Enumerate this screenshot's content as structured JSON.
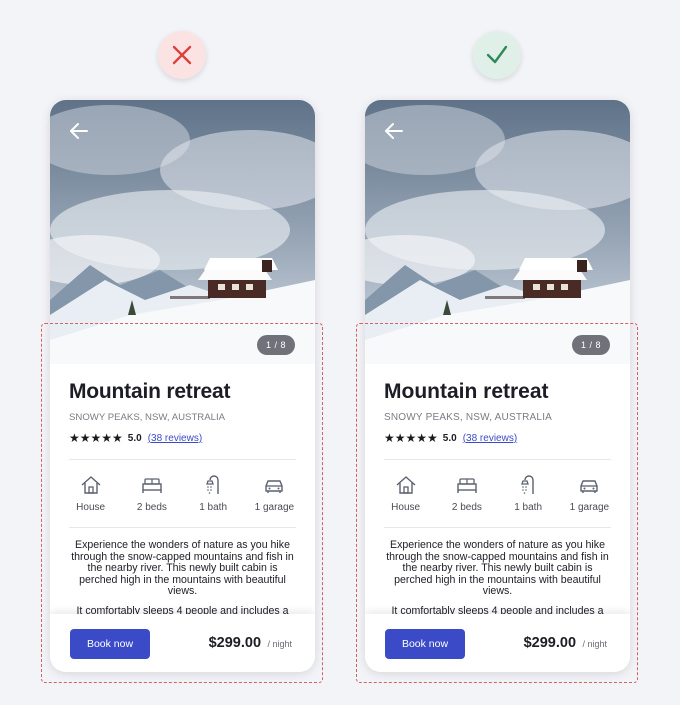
{
  "badges": {
    "bad": {
      "icon": "cross-icon",
      "color": "#d9433e"
    },
    "good": {
      "icon": "check-icon",
      "color": "#2f8a5a"
    }
  },
  "listing": {
    "counter": "1 / 8",
    "title": "Mountain retreat",
    "location": "SNOWY PEAKS, NSW, AUSTRALIA",
    "stars": "★★★★★",
    "score": "5.0",
    "reviews": "(38 reviews)",
    "amenities": [
      {
        "icon": "house-icon",
        "label": "House"
      },
      {
        "icon": "bed-icon",
        "label": "2 beds"
      },
      {
        "icon": "shower-icon",
        "label": "1 bath"
      },
      {
        "icon": "car-icon",
        "label": "1 garage"
      }
    ],
    "desc_p1": "Experience the wonders of nature as you hike through the snow-capped mountains and fish in the nearby river. This newly built cabin is perched high in the mountains with beautiful views.",
    "desc_p2": "It comfortably sleeps 4 people and includes a",
    "book_label": "Book now",
    "price": "$299.00",
    "price_unit": "/ night"
  },
  "left_card": {
    "location": "SNOWY PEAKS, NSW, AUSTRALIA",
    "amenities": [
      "House",
      "2 beds",
      "1 bath",
      "1 garage"
    ],
    "desc_p1": "Experience the wonders of nature as you hike through the snow-capped mountains and fish in the nearby river. This newly built cabin is perched high in the mountains with beautiful views.",
    "desc_p2": "It comfortably sleeps 4 people and includes a"
  },
  "colors": {
    "accent": "#3b4bc8",
    "dashed_outline": "#d46060"
  }
}
